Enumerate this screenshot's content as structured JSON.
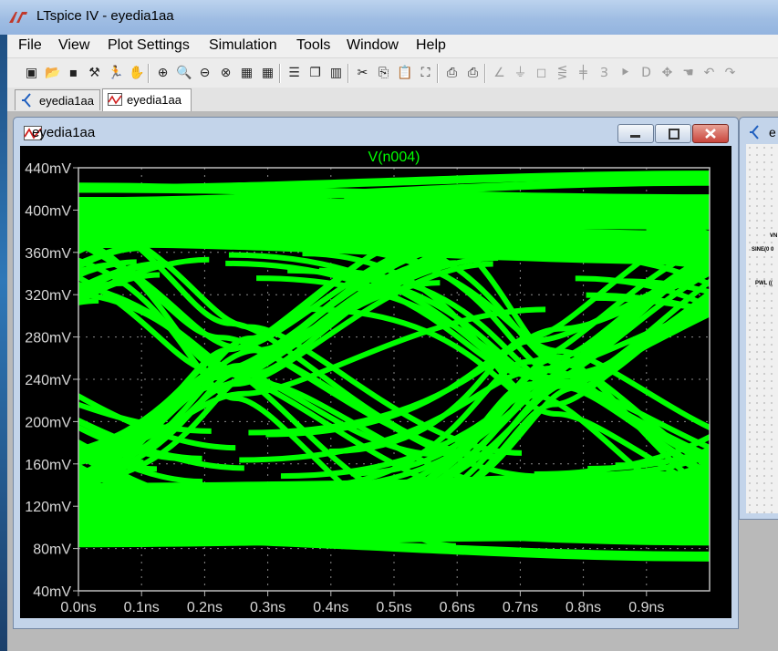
{
  "window": {
    "title": "LTspice IV - eyedia1aa"
  },
  "menu": [
    "File",
    "View",
    "Plot Settings",
    "Simulation",
    "Tools",
    "Window",
    "Help"
  ],
  "toolbar": {
    "icons": [
      "new-schematic-icon",
      "open-icon",
      "save-icon",
      "control-panel-icon",
      "run-icon",
      "halt-icon",
      "zoom-in-icon",
      "zoom-area-icon",
      "zoom-out-icon",
      "zoom-cancel-icon",
      "autorange-icon",
      "grid-icon",
      "tile-horizontal-icon",
      "cascade-icon",
      "tile-vertical-icon",
      "cut-icon",
      "copy-icon",
      "paste-icon",
      "find-icon",
      "print-preview-icon",
      "print-icon",
      "wire-icon",
      "ground-icon",
      "label-icon",
      "resistor-icon",
      "capacitor-icon",
      "inductor-icon",
      "diode-icon",
      "component-icon",
      "move-icon",
      "drag-icon",
      "undo-icon",
      "redo-icon"
    ]
  },
  "tabs": [
    {
      "label": "eyedia1aa",
      "icon": "schematic-icon",
      "active": false
    },
    {
      "label": "eyedia1aa",
      "icon": "waveform-icon",
      "active": true
    }
  ],
  "plot_window": {
    "title": "eyedia1aa",
    "trace_label": "V(n004)"
  },
  "schematic_window": {
    "title": "e",
    "texts": [
      "VN",
      "SINE(0 0",
      "PWL (("
    ]
  },
  "colors": {
    "trace": "#00ff00",
    "plot_bg": "#000000",
    "axis": "#aaaaaa",
    "close_button": "#c9463d"
  },
  "chart_data": {
    "type": "line",
    "title": "",
    "trace": "V(n004)",
    "xlabel": "",
    "ylabel": "",
    "x_ticks": [
      "0.0ns",
      "0.1ns",
      "0.2ns",
      "0.3ns",
      "0.4ns",
      "0.5ns",
      "0.6ns",
      "0.7ns",
      "0.8ns",
      "0.9ns"
    ],
    "y_ticks": [
      "40mV",
      "80mV",
      "120mV",
      "160mV",
      "200mV",
      "240mV",
      "280mV",
      "320mV",
      "360mV",
      "400mV",
      "440mV"
    ],
    "xlim": [
      0,
      1.0
    ],
    "ylim": [
      40,
      440
    ],
    "grid": true,
    "description_series": [
      {
        "name": "V(n004)",
        "x": [
          0.0,
          0.1,
          0.2,
          0.3,
          0.4,
          0.5,
          0.6,
          0.7,
          0.8,
          0.9,
          1.0
        ],
        "upper_eye": [
          300,
          290,
          250,
          280,
          320,
          300,
          270,
          250,
          290,
          300,
          320
        ],
        "lower_eye": [
          140,
          150,
          240,
          210,
          180,
          140,
          170,
          250,
          220,
          170,
          140
        ]
      }
    ]
  }
}
